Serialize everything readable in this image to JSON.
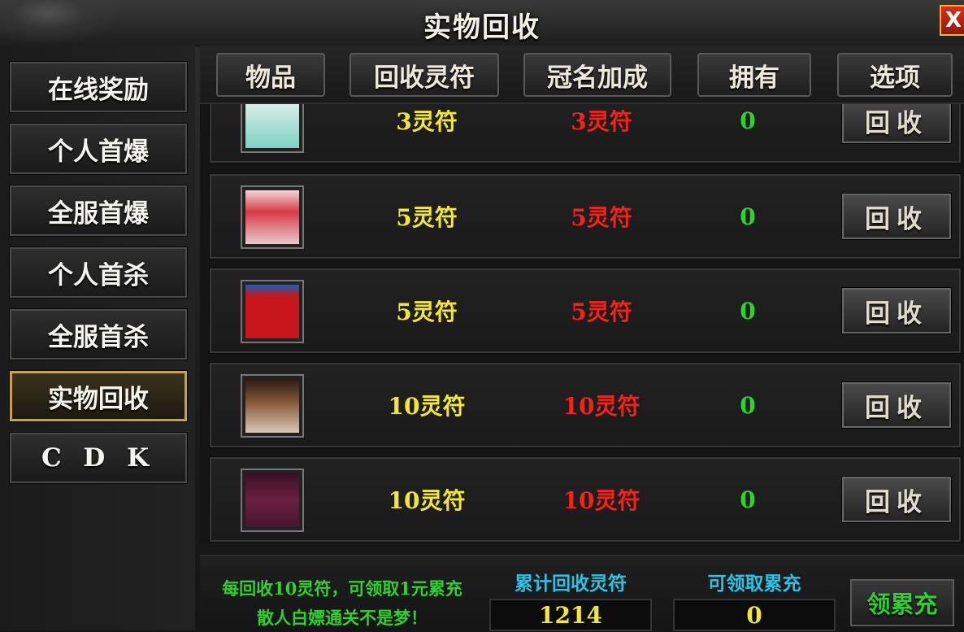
{
  "window": {
    "title": "实物回收",
    "close_label": "X"
  },
  "sidebar": {
    "items": [
      {
        "label": "在线奖励"
      },
      {
        "label": "个人首爆"
      },
      {
        "label": "全服首爆"
      },
      {
        "label": "个人首杀"
      },
      {
        "label": "全服首杀"
      },
      {
        "label": "实物回收",
        "active": true
      },
      {
        "label": "C D K"
      }
    ]
  },
  "table": {
    "headers": [
      "物品",
      "回收灵符",
      "冠名加成",
      "拥有",
      "选项"
    ],
    "rows": [
      {
        "item_icon": "cigarette-pack-icon",
        "color": "#7fd1c4",
        "recycle_fu": "3灵符",
        "bonus": "3灵符",
        "owned": "0",
        "action": "回收"
      },
      {
        "item_icon": "cigarette-pack-icon",
        "color": "#d63a45",
        "recycle_fu": "5灵符",
        "bonus": "5灵符",
        "owned": "0",
        "action": "回收"
      },
      {
        "item_icon": "cigarette-pack-icon",
        "color": "#c8161b",
        "recycle_fu": "5灵符",
        "bonus": "5灵符",
        "owned": "0",
        "action": "回收"
      },
      {
        "item_icon": "cigarette-pack-icon",
        "color": "#5a3a2a",
        "recycle_fu": "10灵符",
        "bonus": "10灵符",
        "owned": "0",
        "action": "回收"
      },
      {
        "item_icon": "cigarette-pack-icon",
        "color": "#4a1630",
        "recycle_fu": "10灵符",
        "bonus": "10灵符",
        "owned": "0",
        "action": "回收"
      }
    ]
  },
  "footer": {
    "promo_line1": "每回收10灵符，可领取1元累充",
    "promo_line2": "散人白嫖通关不是梦！",
    "total_label": "累计回收灵符",
    "total_value": "1214",
    "claimable_label": "可领取累充",
    "claimable_value": "0",
    "claim_button": "领累充"
  }
}
